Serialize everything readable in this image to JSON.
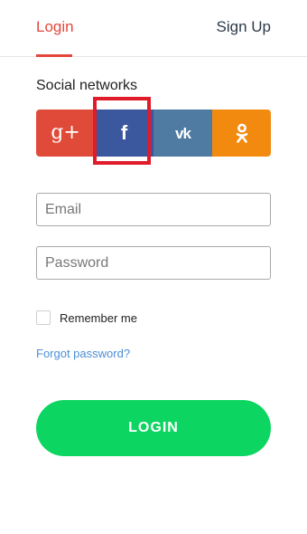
{
  "tabs": {
    "login": "Login",
    "signup": "Sign Up"
  },
  "social": {
    "title": "Social networks",
    "buttons": [
      {
        "name": "google-plus",
        "glyph": "g+",
        "color": "#e04b39"
      },
      {
        "name": "facebook",
        "glyph": "f",
        "color": "#3b579d"
      },
      {
        "name": "vkontakte",
        "glyph": "vk",
        "color": "#4f7aa2"
      },
      {
        "name": "odnoklassniki",
        "glyph": "ok",
        "color": "#f38a10"
      }
    ]
  },
  "form": {
    "email_placeholder": "Email",
    "password_placeholder": "Password",
    "remember_label": "Remember me",
    "forgot_label": "Forgot password?",
    "login_label": "LOGIN"
  },
  "colors": {
    "accent": "#e4473b",
    "login_button": "#0dd561",
    "link": "#4b8fd6",
    "highlight": "#e01b2a"
  }
}
